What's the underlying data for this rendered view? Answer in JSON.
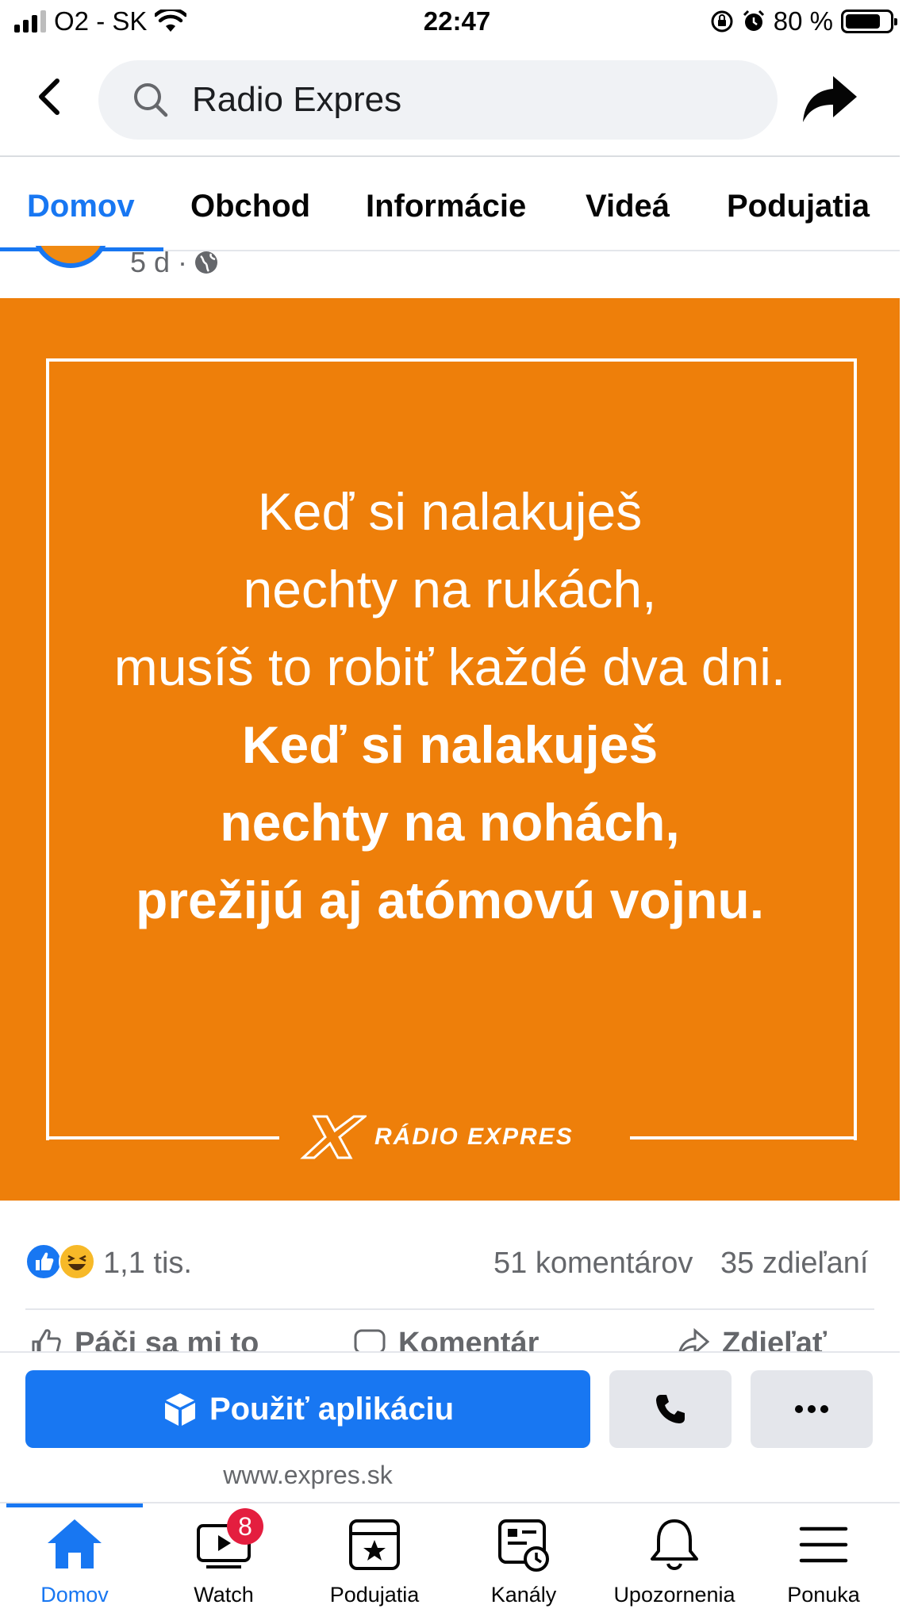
{
  "status_bar": {
    "carrier": "O2 - SK",
    "time": "22:47",
    "battery_percent": "80 %",
    "battery_level": 0.8
  },
  "search": {
    "query": "Radio Expres"
  },
  "tabs": [
    {
      "label": "Domov",
      "active": true
    },
    {
      "label": "Obchod",
      "active": false
    },
    {
      "label": "Informácie",
      "active": false
    },
    {
      "label": "Videá",
      "active": false
    },
    {
      "label": "Podujatia",
      "active": false
    }
  ],
  "post": {
    "time_ago": "5 d ·",
    "image": {
      "lines_light": [
        "Keď si nalakuješ",
        "nechty na rukách,",
        "musíš to robiť každé dva dni."
      ],
      "lines_bold": [
        "Keď si nalakuješ",
        "nechty na nohách,",
        "prežijú aj atómovú vojnu."
      ],
      "brand": "RÁDIO EXPRES",
      "background_color": "#ee7f0a"
    },
    "reactions_count": "1,1 tis.",
    "comments_count": "51 komentárov",
    "shares_count": "35 zdieľaní",
    "actions": {
      "like": "Páči sa mi to",
      "comment": "Komentár",
      "share": "Zdieľať"
    }
  },
  "cta": {
    "use_app_label": "Použiť aplikáciu",
    "website": "www.expres.sk"
  },
  "bottom_nav": [
    {
      "label": "Domov",
      "icon": "home-icon",
      "active": true
    },
    {
      "label": "Watch",
      "icon": "watch-icon",
      "badge": "8"
    },
    {
      "label": "Podujatia",
      "icon": "events-icon"
    },
    {
      "label": "Kanály",
      "icon": "feeds-icon"
    },
    {
      "label": "Upozornenia",
      "icon": "bell-icon"
    },
    {
      "label": "Ponuka",
      "icon": "menu-icon"
    }
  ],
  "colors": {
    "accent": "#1877f2",
    "post_orange": "#ee7f0a",
    "badge_red": "#e41e3f"
  }
}
